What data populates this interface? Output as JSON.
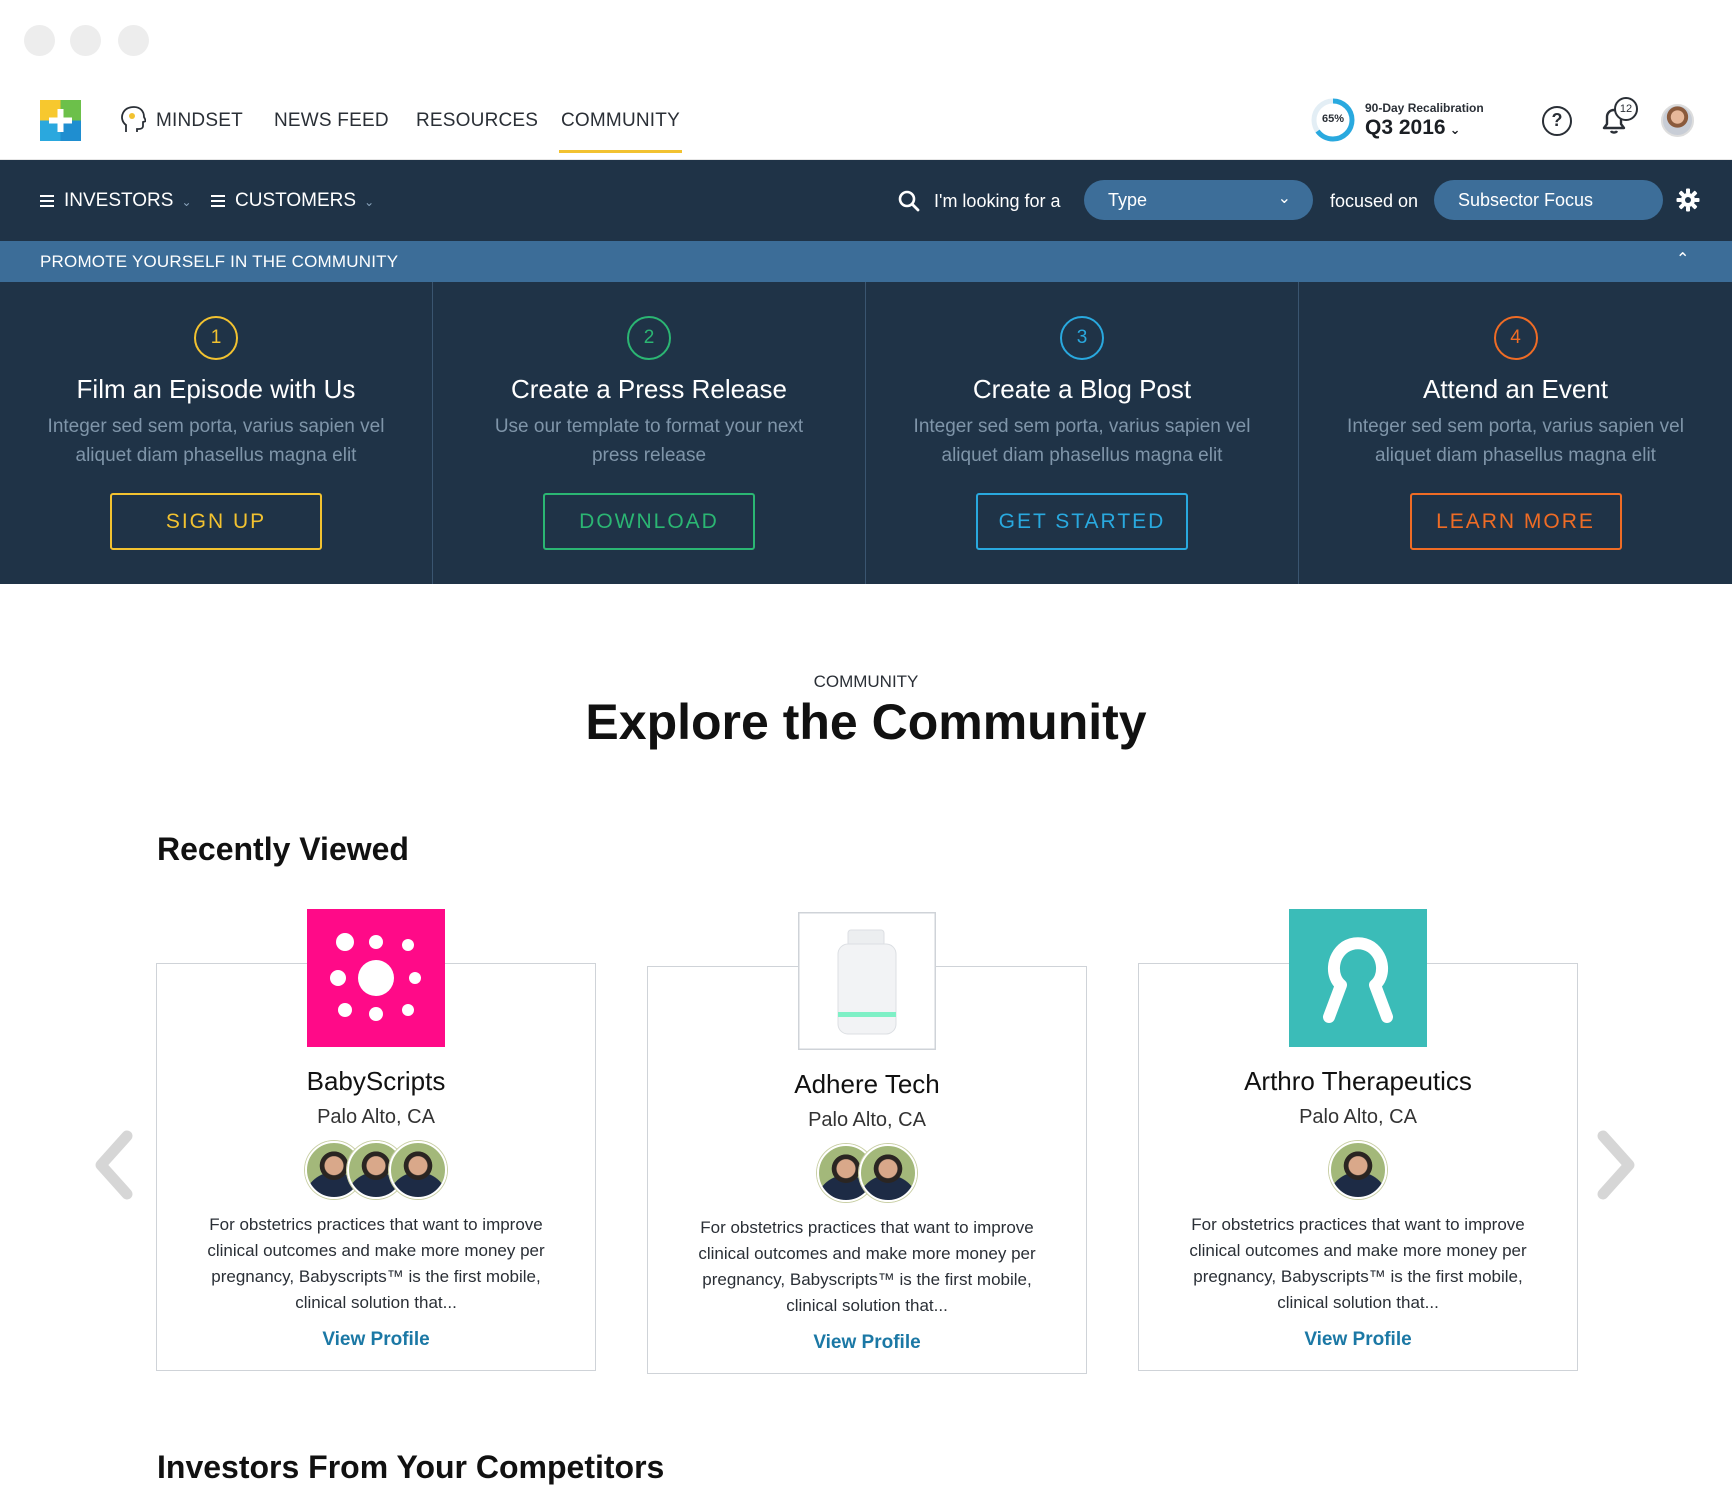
{
  "nav": {
    "items": [
      {
        "label": "MINDSET"
      },
      {
        "label": "NEWS FEED"
      },
      {
        "label": "RESOURCES"
      },
      {
        "label": "COMMUNITY"
      }
    ],
    "recalibration": {
      "percent": "65%",
      "label": "90-Day Recalibration",
      "value": "Q3 2016"
    },
    "help_label": "?",
    "notifications_count": "12"
  },
  "filter": {
    "investors_label": "INVESTORS",
    "customers_label": "CUSTOMERS",
    "looking_for_label": "I'm looking for a",
    "type_select": "Type",
    "focused_on_label": "focused on",
    "subsector_select": "Subsector Focus"
  },
  "promote": {
    "label": "PROMOTE YOURSELF IN THE COMMUNITY"
  },
  "steps": [
    {
      "num": "1",
      "title": "Film an Episode with Us",
      "desc": "Integer sed sem porta, varius sapien vel aliquet diam phasellus magna elit",
      "button": "SIGN UP",
      "color": "#f2c230"
    },
    {
      "num": "2",
      "title": "Create a Press Release",
      "desc": "Use our template to format your next press release",
      "button": "DOWNLOAD",
      "color": "#2bb673"
    },
    {
      "num": "3",
      "title": "Create a Blog Post",
      "desc": "Integer sed sem porta, varius sapien vel aliquet diam phasellus magna elit",
      "button": "GET STARTED",
      "color": "#29a9df"
    },
    {
      "num": "4",
      "title": "Attend an Event",
      "desc": "Integer sed sem porta, varius sapien vel aliquet diam phasellus magna elit",
      "button": "LEARN MORE",
      "color": "#ef6c25"
    }
  ],
  "explore": {
    "eyebrow": "COMMUNITY",
    "headline": "Explore the Community"
  },
  "recently_viewed": {
    "title": "Recently Viewed",
    "cards": [
      {
        "name": "BabyScripts",
        "location": "Palo Alto, CA",
        "desc": "For obstetrics practices that want to improve clinical outcomes and make more money per pregnancy, Babyscripts™ is the first mobile, clinical solution that...",
        "link": "View Profile",
        "logo_color": "#ff0a88"
      },
      {
        "name": "Adhere Tech",
        "location": "Palo Alto, CA",
        "desc": "For obstetrics practices that want to improve clinical outcomes and make more money per pregnancy, Babyscripts™ is the first mobile, clinical solution that...",
        "link": "View Profile",
        "logo_color": "#ffffff"
      },
      {
        "name": "Arthro Therapeutics",
        "location": "Palo Alto, CA",
        "desc": "For obstetrics practices that want to improve clinical outcomes and make more money per pregnancy, Babyscripts™ is the first mobile, clinical solution that...",
        "link": "View Profile",
        "logo_color": "#3bbcb8"
      }
    ]
  },
  "competitors": {
    "title": "Investors From Your Competitors"
  }
}
